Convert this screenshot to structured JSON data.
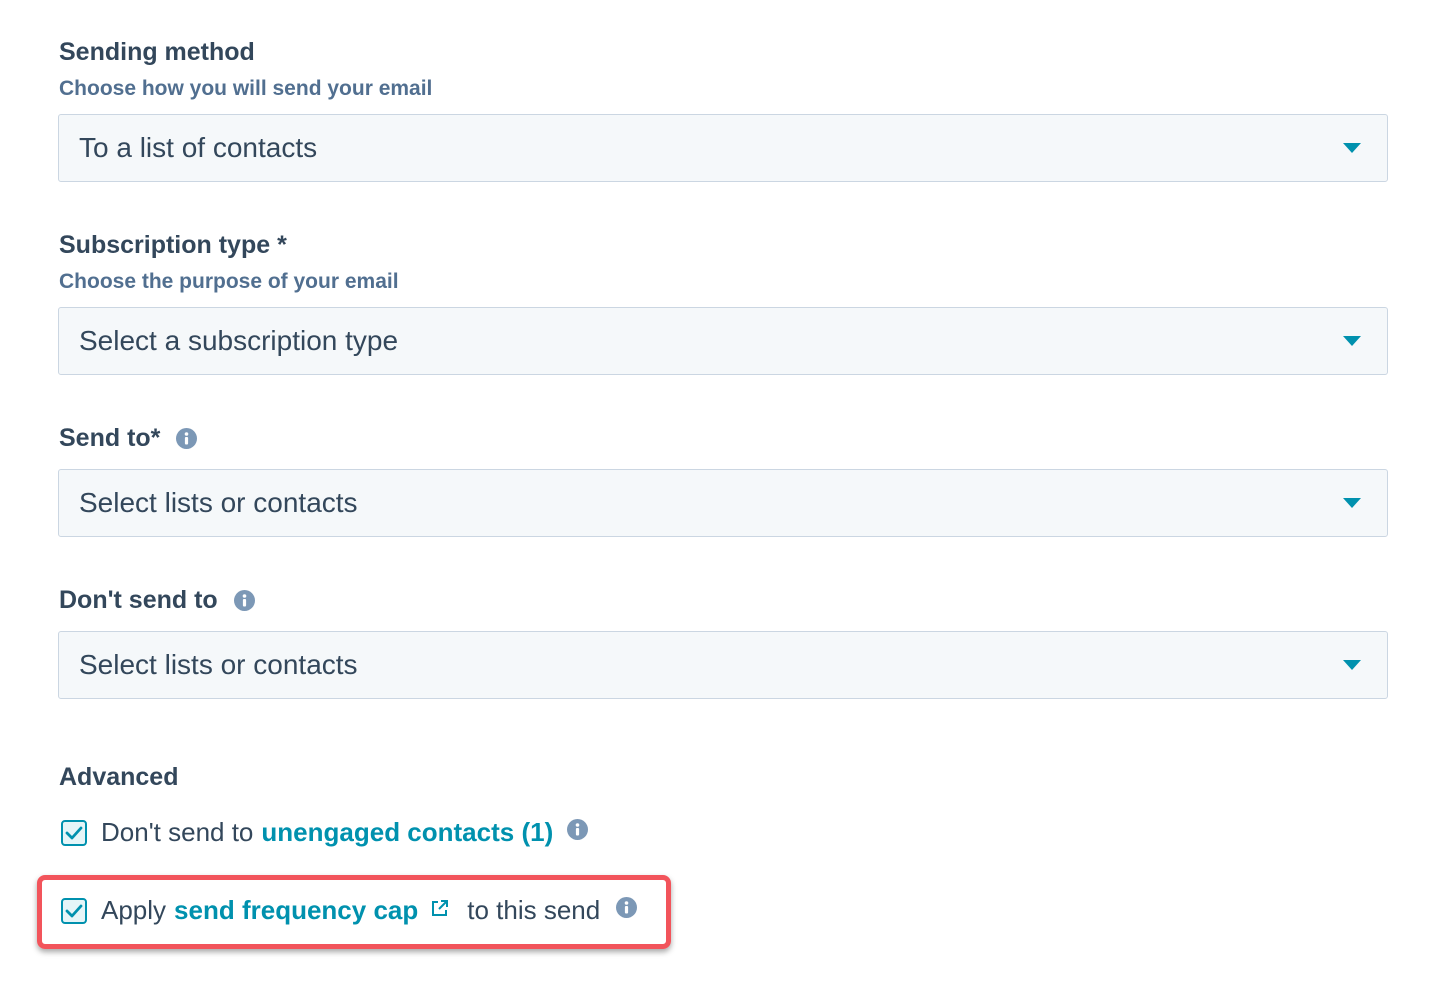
{
  "sending_method": {
    "label": "Sending method",
    "help": "Choose how you will send your email",
    "value": "To a list of contacts"
  },
  "subscription_type": {
    "label": "Subscription type *",
    "help": "Choose the purpose of your email",
    "value": "Select a subscription type"
  },
  "send_to": {
    "label": "Send to*",
    "value": "Select lists or contacts"
  },
  "dont_send_to": {
    "label": "Don't send to",
    "value": "Select lists or contacts"
  },
  "advanced": {
    "label": "Advanced",
    "unengaged": {
      "prefix": "Don't send to",
      "link": "unengaged contacts (1)",
      "checked": true
    },
    "frequency_cap": {
      "prefix": "Apply",
      "link": "send frequency cap",
      "suffix": "to this send",
      "checked": true
    }
  },
  "icons": {
    "info": "info-icon",
    "external_link": "external-link-icon",
    "check": "check-icon",
    "dropdown": "caret-down-icon"
  },
  "colors": {
    "accent": "#0091ae",
    "text": "#33475b",
    "help_text": "#516f90",
    "highlight": "#f2545b"
  }
}
